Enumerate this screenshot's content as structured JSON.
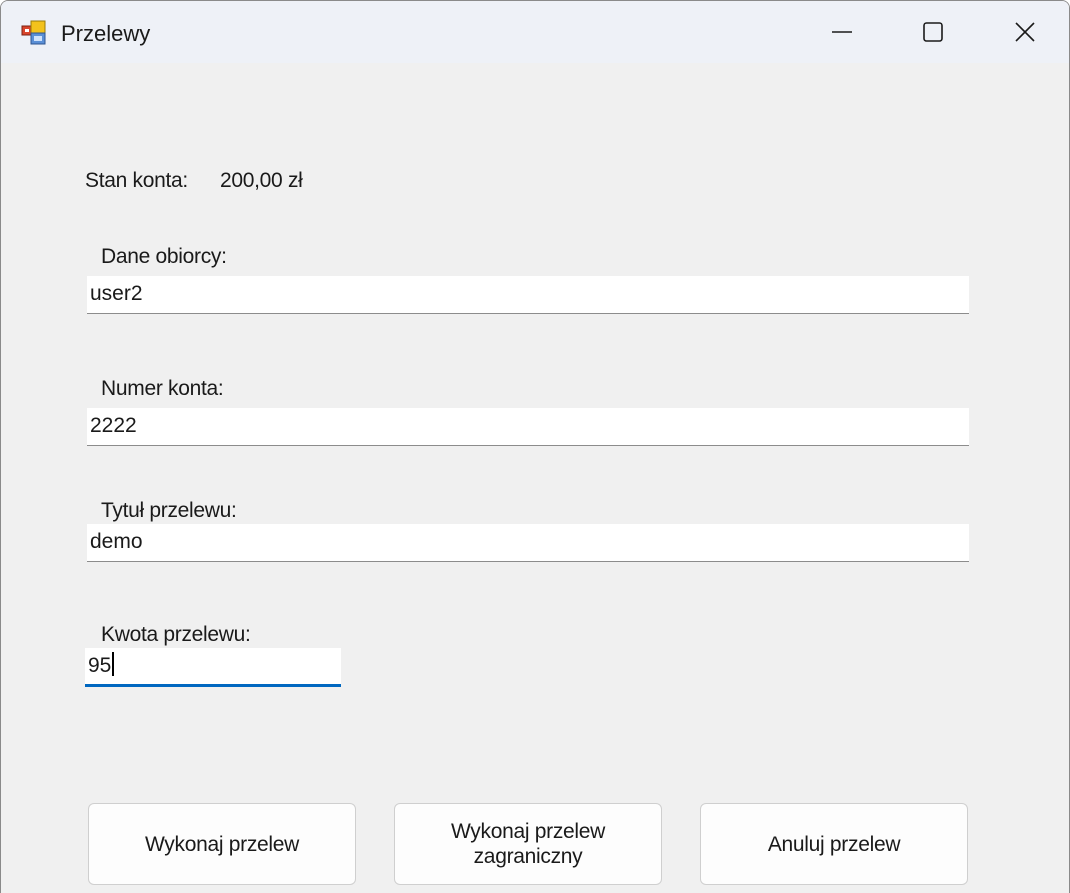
{
  "window": {
    "title": "Przelewy",
    "icon": "windows-forms-app-icon",
    "controls": [
      "minimize-icon",
      "maximize-icon",
      "close-icon"
    ]
  },
  "balance": {
    "label": "Stan konta:",
    "value": "200,00 zł"
  },
  "fields": {
    "recipient": {
      "label": "Dane obiorcy:",
      "value": "user2"
    },
    "account_number": {
      "label": "Numer konta:",
      "value": "2222"
    },
    "title": {
      "label": "Tytuł przelewu:",
      "value": "demo"
    },
    "amount": {
      "label": "Kwota przelewu:",
      "value": "95"
    }
  },
  "buttons": {
    "transfer": "Wykonaj przelew",
    "foreign_transfer": "Wykonaj przelew zagraniczny",
    "cancel": "Anuluj przelew"
  },
  "colors": {
    "focus_accent": "#0067c0",
    "window_background": "#f0f0f0",
    "titlebar_background": "#eef1f7"
  }
}
